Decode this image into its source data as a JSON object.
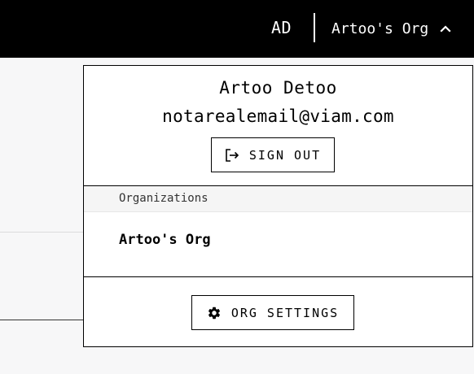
{
  "header": {
    "user_initials": "AD",
    "current_org": "Artoo's Org"
  },
  "user_menu": {
    "name": "Artoo Detoo",
    "email": "notarealemail@viam.com",
    "sign_out_label": "SIGN OUT",
    "organizations_heading": "Organizations",
    "organizations": [
      {
        "label": "Artoo's Org"
      }
    ],
    "org_settings_label": "ORG SETTINGS"
  },
  "colors": {
    "topbar_bg": "#000000",
    "panel_bg": "#ffffff",
    "section_header_bg": "#f5f5f5"
  }
}
